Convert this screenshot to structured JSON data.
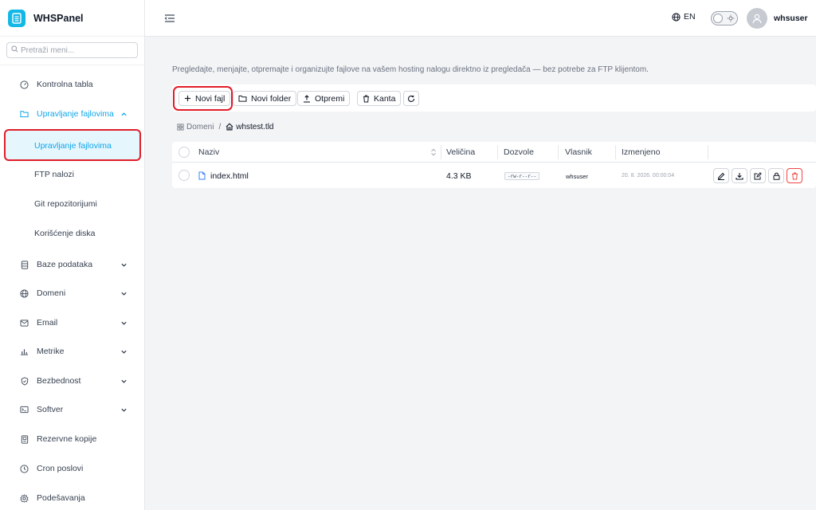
{
  "app": {
    "name": "WHSPanel"
  },
  "search": {
    "placeholder": "Pretraži meni..."
  },
  "sidebar": {
    "items": [
      {
        "label": "Kontrolna tabla",
        "icon": "dashboard-icon"
      },
      {
        "label": "Upravljanje fajlovima",
        "icon": "folder-icon",
        "expanded": true
      },
      {
        "label": "Baze podataka",
        "icon": "database-icon"
      },
      {
        "label": "Domeni",
        "icon": "globe-icon"
      },
      {
        "label": "Email",
        "icon": "mail-icon"
      },
      {
        "label": "Metrike",
        "icon": "chart-icon"
      },
      {
        "label": "Bezbednost",
        "icon": "shield-icon"
      },
      {
        "label": "Softver",
        "icon": "terminal-icon"
      },
      {
        "label": "Rezervne kopije",
        "icon": "backup-icon"
      },
      {
        "label": "Cron poslovi",
        "icon": "clock-icon"
      },
      {
        "label": "Podešavanja",
        "icon": "gear-icon"
      }
    ],
    "subitems": [
      {
        "label": "Upravljanje fajlovima"
      },
      {
        "label": "FTP nalozi"
      },
      {
        "label": "Git repozitorijumi"
      },
      {
        "label": "Korišćenje diska"
      }
    ]
  },
  "header": {
    "language": "EN",
    "username": "whsuser"
  },
  "main": {
    "description": "Pregledajte, menjajte, otpremajte i organizujte fajlove na vašem hosting nalogu direktno iz pregledača — bez potrebe za FTP klijentom.",
    "toolbar": {
      "new_file": "Novi fajl",
      "new_folder": "Novi folder",
      "upload": "Otpremi",
      "trash": "Kanta"
    },
    "breadcrumb": {
      "root": "Domeni",
      "current": "whstest.tld"
    },
    "table": {
      "columns": [
        "Naziv",
        "Veličina",
        "Dozvole",
        "Vlasnik",
        "Izmenjeno"
      ],
      "rows": [
        {
          "name": "index.html",
          "size": "4.3 KB",
          "permissions": "-rw-r--r--",
          "owner": "whsuser",
          "modified": "20. 8. 2026. 00:00:04"
        }
      ]
    }
  },
  "colors": {
    "accent": "#0ea5e9",
    "brand": "#14b8e6",
    "highlight": "#e11d2a",
    "danger": "#ef4444"
  }
}
